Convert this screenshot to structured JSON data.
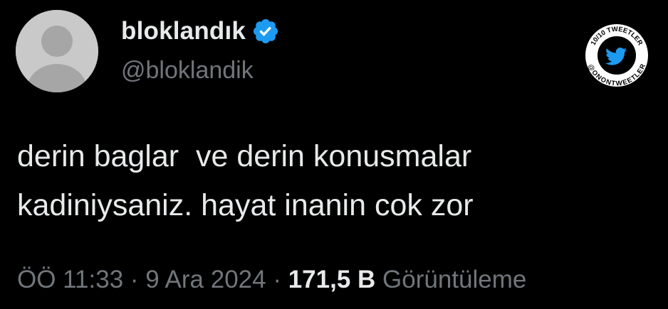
{
  "author": {
    "display_name": "bloklandık",
    "handle": "@bloklandik",
    "verified_icon": "verified-badge-icon",
    "verified_color": "#1d9bf0"
  },
  "tweet": {
    "text": "derin baglar  ve derin konusmalar\nkadiniysaniz. hayat inanin cok zor"
  },
  "meta": {
    "time": "ÖÖ 11:33",
    "separator": " · ",
    "date": "9 Ara 2024",
    "views_count": "171,5 B",
    "views_label": "Görüntüleme"
  },
  "watermark": {
    "top_text": "10/10 TWEETLER",
    "bottom_text": "@ONONTWEETLER",
    "icon": "bird-icon",
    "accent_color": "#1d9bf0"
  },
  "colors": {
    "background": "#000000",
    "primary_text": "#e7e9ea",
    "secondary_text": "#71767b"
  }
}
